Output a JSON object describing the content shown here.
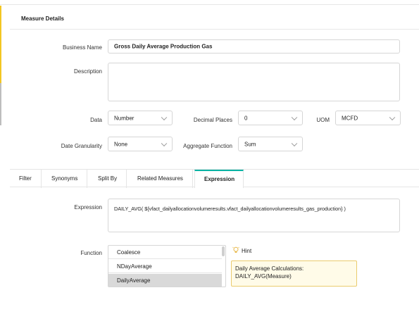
{
  "section": {
    "title": "Measure Details"
  },
  "fields": {
    "business_name": {
      "label": "Business Name",
      "value": "Gross Daily Average Production Gas"
    },
    "description": {
      "label": "Description",
      "value": ""
    },
    "data": {
      "label": "Data",
      "value": "Number"
    },
    "decimal_places": {
      "label": "Decimal Places",
      "value": "0"
    },
    "uom": {
      "label": "UOM",
      "value": "MCFD"
    },
    "date_granularity": {
      "label": "Date Granularity",
      "value": "None"
    },
    "aggregate_function": {
      "label": "Aggregate Function",
      "value": "Sum"
    }
  },
  "tabs": [
    {
      "label": "Filter"
    },
    {
      "label": "Synonyms"
    },
    {
      "label": "Split By"
    },
    {
      "label": "Related Measures"
    },
    {
      "label": "Expression",
      "active": true
    }
  ],
  "expression": {
    "label": "Expression",
    "value": "DAILY_AVG( ${vfact_dailyallocationvolumeresults.vfact_dailyallocationvolumeresults_gas_production} )"
  },
  "function": {
    "label": "Function",
    "items": [
      "Coalesce",
      "NDayAverage",
      "DailyAverage"
    ],
    "selected": "DailyAverage"
  },
  "hint": {
    "icon": "lightbulb-icon",
    "label": "Hint",
    "line1": "Daily Average Calculations:",
    "line2": "DAILY_AVG(Measure)"
  },
  "colors": {
    "accent": "#f3c623",
    "tab_active": "#00b3a4",
    "hint_border": "#eacb6d",
    "hint_bg": "#fffbe8"
  }
}
